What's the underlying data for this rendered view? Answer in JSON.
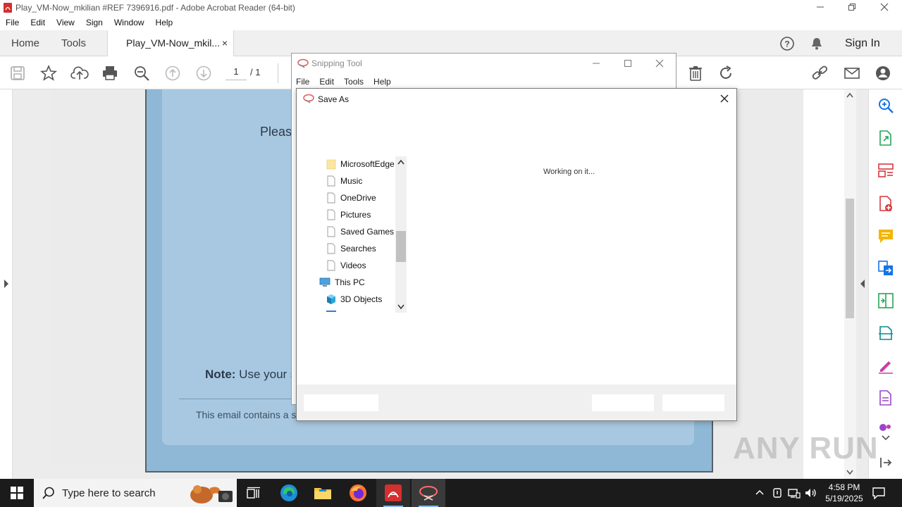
{
  "window": {
    "title": "Play_VM-Now_mkilian #REF 7396916.pdf - Adobe Acrobat Reader (64-bit)"
  },
  "menubar": [
    "File",
    "Edit",
    "View",
    "Sign",
    "Window",
    "Help"
  ],
  "tabs": {
    "home": "Home",
    "tools": "Tools",
    "document": "Play_VM-Now_mkil...",
    "document_close": "×",
    "sign_in": "Sign In"
  },
  "toolbar": {
    "page_current": "1",
    "page_total": "/ 1"
  },
  "document": {
    "text_please": "Pleas",
    "note_label": "Note:",
    "note_text": " Use your s",
    "footer_text": "This email contains a s"
  },
  "snipping_tool": {
    "title": "Snipping Tool",
    "menu": [
      "File",
      "Edit",
      "Tools",
      "Help"
    ]
  },
  "save_as": {
    "title": "Save As",
    "status": "Working on it...",
    "tree": [
      {
        "label": "MicrosoftEdge",
        "icon": "folder-icon"
      },
      {
        "label": "Music",
        "icon": "page-icon"
      },
      {
        "label": "OneDrive",
        "icon": "page-icon"
      },
      {
        "label": "Pictures",
        "icon": "page-icon"
      },
      {
        "label": "Saved Games",
        "icon": "page-icon"
      },
      {
        "label": "Searches",
        "icon": "page-icon"
      },
      {
        "label": "Videos",
        "icon": "page-icon"
      },
      {
        "label": "This PC",
        "icon": "computer-icon"
      },
      {
        "label": "3D Objects",
        "icon": "cube-icon"
      }
    ]
  },
  "taskbar": {
    "search_placeholder": "Type here to search",
    "time": "4:58 PM",
    "date": "5/19/2025"
  },
  "watermark": "ANY RUN"
}
